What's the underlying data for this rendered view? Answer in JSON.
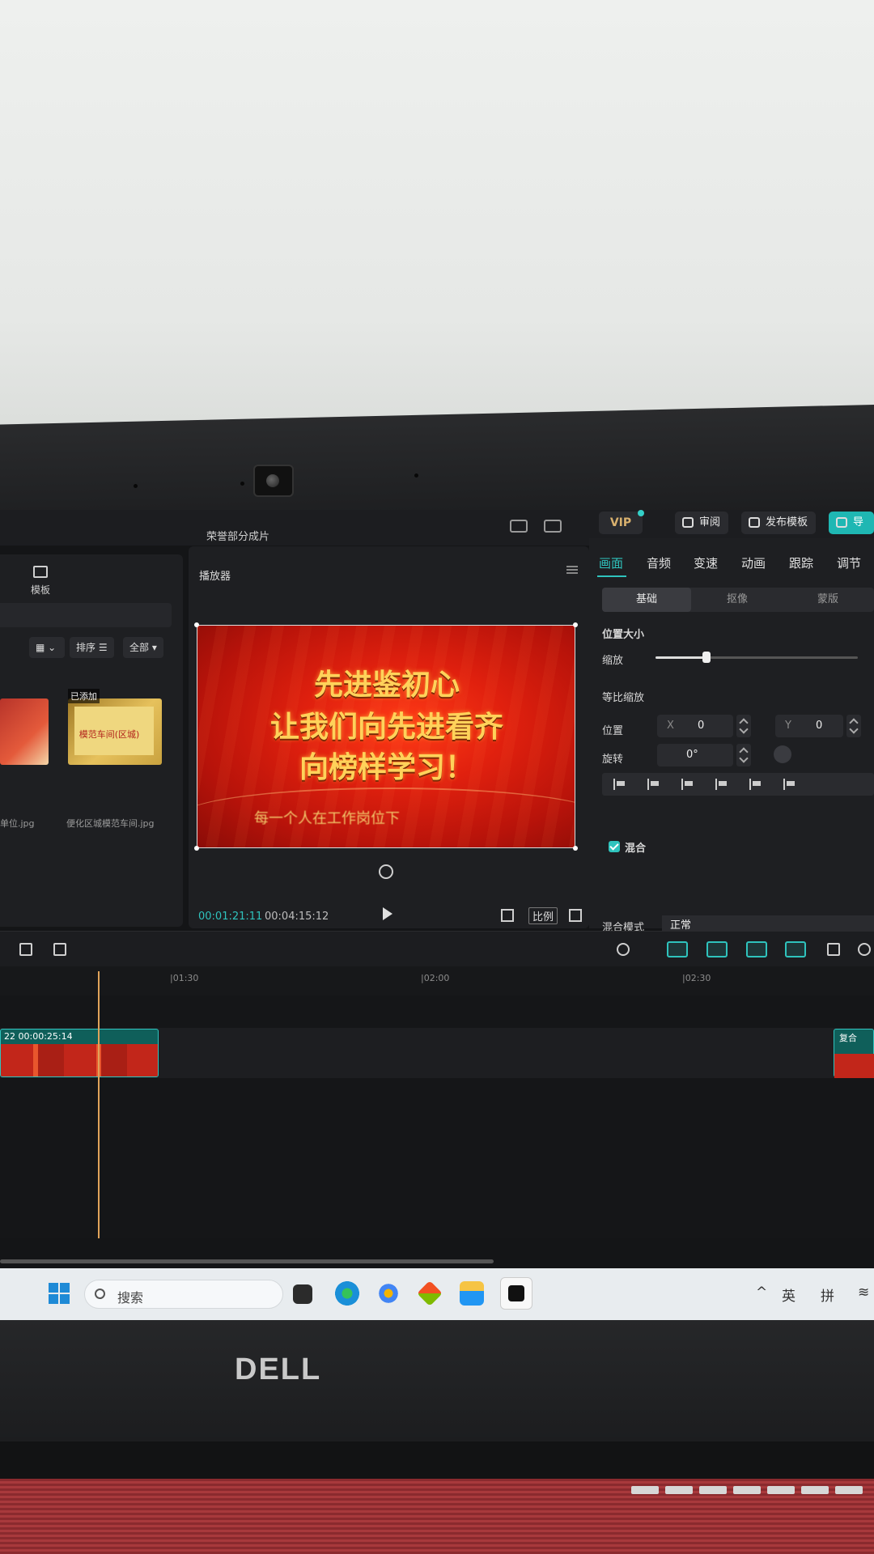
{
  "app": {
    "project_title": "荣誉部分成片",
    "vip_label": "VIP",
    "review_label": "审阅",
    "publish_template_label": "发布模板",
    "export_label": "导出"
  },
  "left_panel": {
    "tab_template": "模板",
    "sort_label": "排序",
    "filter_label": "全部",
    "added_badge": "已添加",
    "thumb2_text": "模范车间(区城)",
    "files": [
      "单位.jpg",
      "便化区城模范车间.jpg"
    ]
  },
  "player": {
    "label": "播放器",
    "slogan": [
      "先进鉴初心",
      "让我们向先进看齐",
      "向榜样学习！"
    ],
    "subtitle": "每一个人在工作岗位下",
    "current_time": "00:01:21:11",
    "total_time": "00:04:15:12",
    "ratio_label": "比例"
  },
  "right_panel": {
    "tabs": [
      "画面",
      "音频",
      "变速",
      "动画",
      "跟踪",
      "调节"
    ],
    "segments": [
      "基础",
      "抠像",
      "蒙版"
    ],
    "section_position_size": "位置大小",
    "scale_label": "缩放",
    "scale_value": 0.25,
    "uniform_scale_label": "等比缩放",
    "position_label": "位置",
    "x_prefix": "X",
    "x_value": "0",
    "y_prefix": "Y",
    "y_value": "0",
    "rotation_label": "旋转",
    "rotation_value": "0°",
    "blend_section": "混合",
    "blend_mode_label": "混合模式",
    "blend_mode_value": "正常"
  },
  "timeline": {
    "ticks": [
      "|01:30",
      "|02:00",
      "|02:30"
    ],
    "clip_label": "22  00:00:25:14",
    "clip2_label": "复合"
  },
  "taskbar": {
    "search_placeholder": "搜索",
    "tray_lang": "英",
    "tray_ime": "拼"
  },
  "laptop": {
    "brand": "DELL"
  }
}
